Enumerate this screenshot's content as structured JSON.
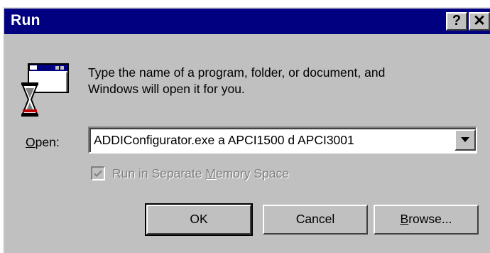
{
  "window": {
    "title": "Run",
    "help_button": "?",
    "close_button": "✕"
  },
  "dialog": {
    "instruction_line1": "Type the name of a program, folder, or document, and",
    "instruction_line2": "Windows will open it for you.",
    "open_label_accel": "O",
    "open_label_rest": "pen:",
    "open_value": "ADDIConfigurator.exe a APCI1500 d APCI3001",
    "checkbox_checked": true,
    "checkbox_enabled": false,
    "checkbox_label_pre": "Run in Separate ",
    "checkbox_label_accel": "M",
    "checkbox_label_post": "emory Space"
  },
  "buttons": {
    "ok": "OK",
    "cancel": "Cancel",
    "browse_accel": "B",
    "browse_rest": "rowse..."
  },
  "icons": {
    "program": "run-program-icon",
    "dropdown": "chevron-down-icon",
    "check": "checkmark-icon"
  },
  "colors": {
    "titlebar": "#000080",
    "face": "#c0c0c0",
    "disabled_text": "#808080"
  }
}
